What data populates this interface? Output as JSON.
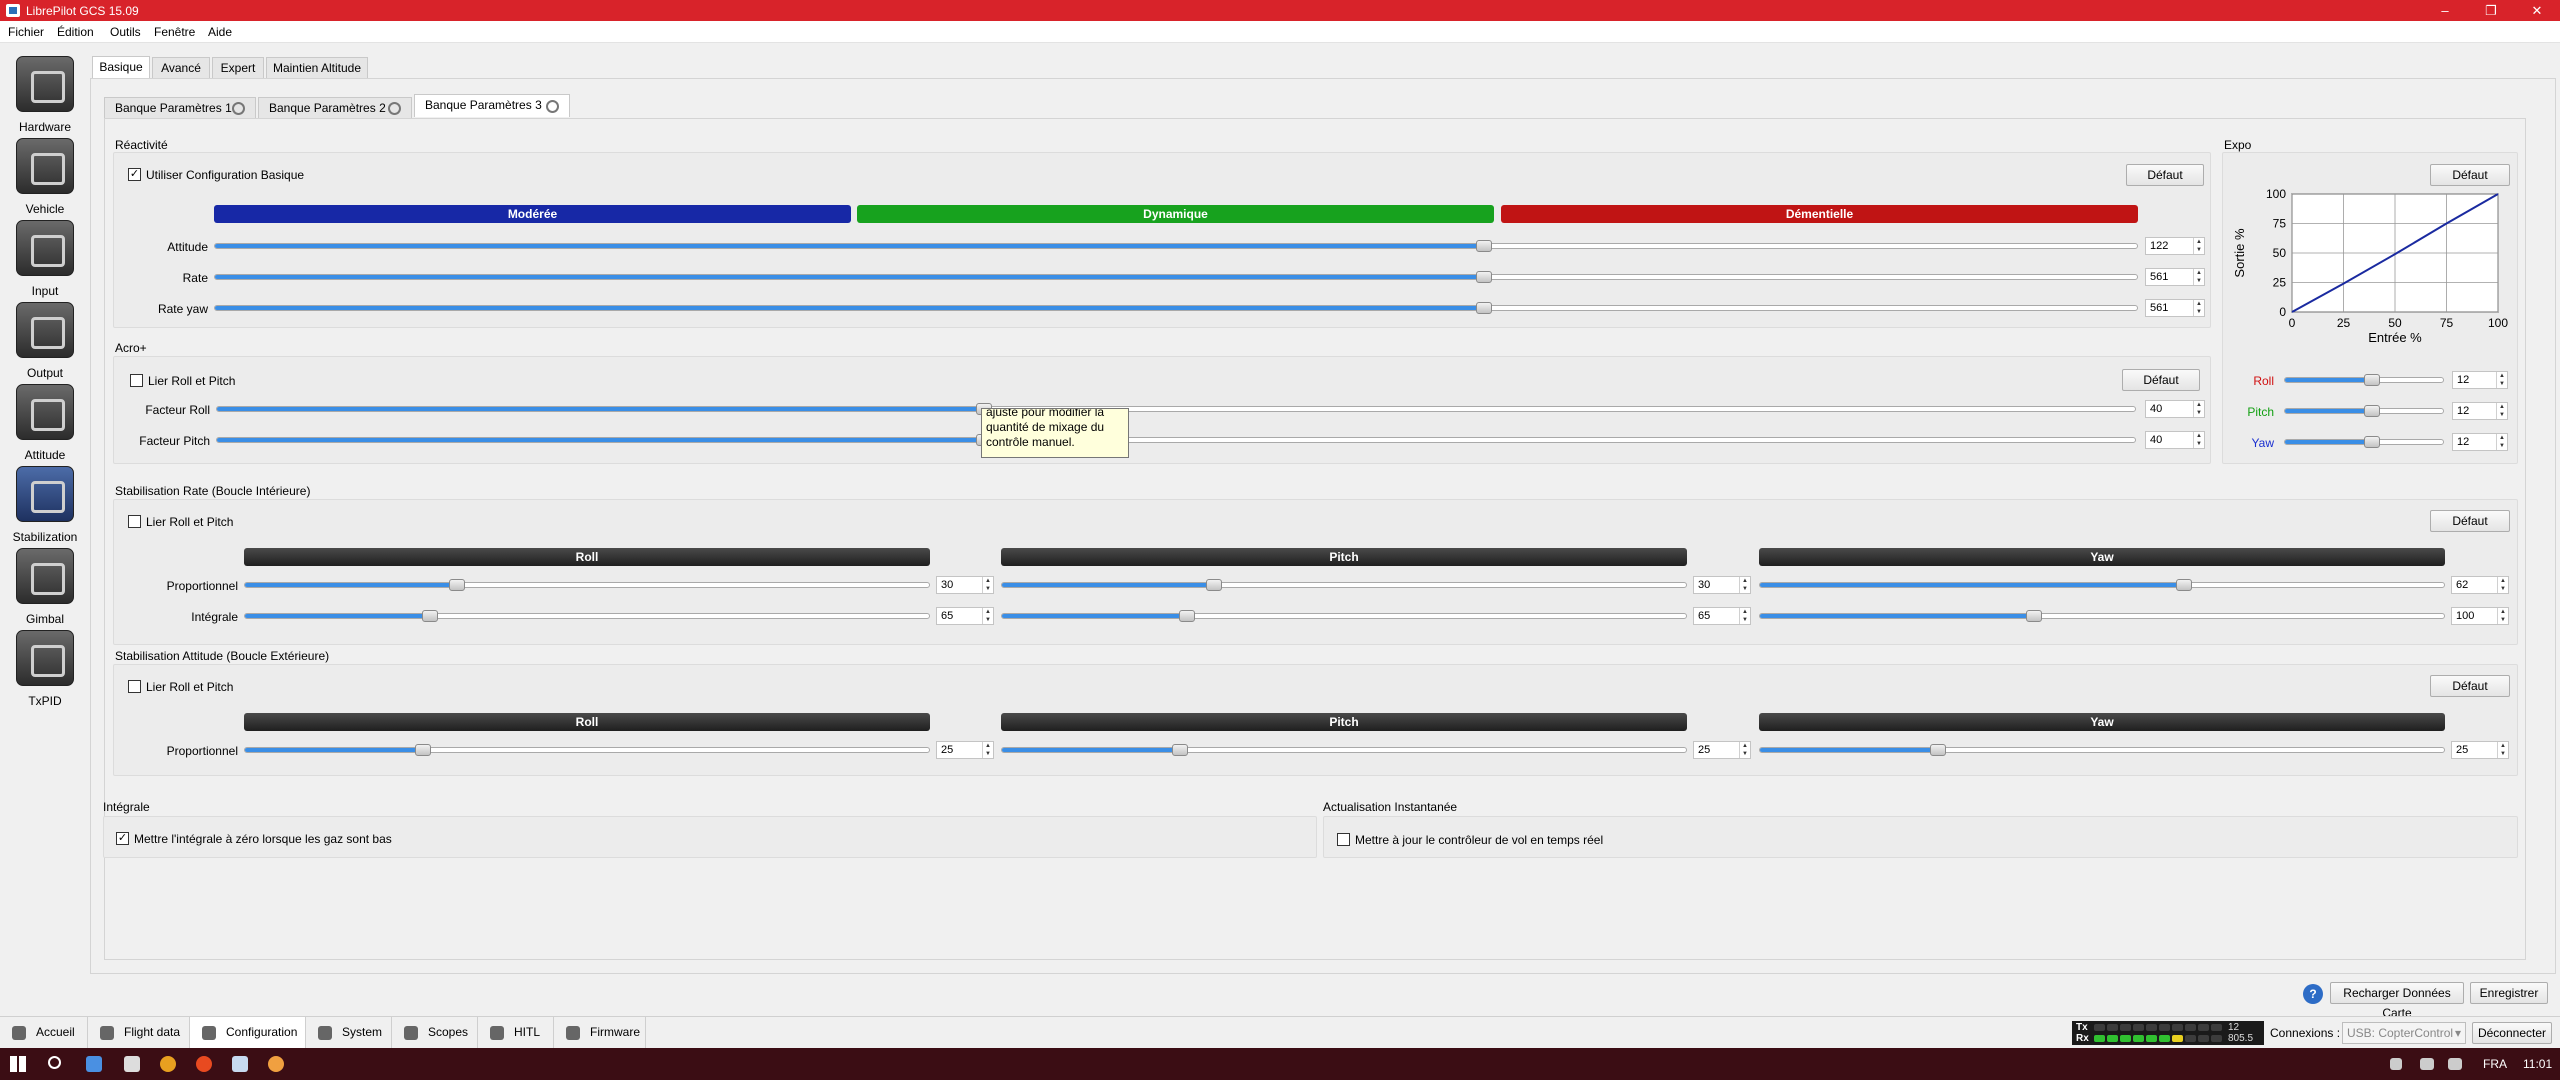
{
  "window": {
    "title": "LibrePilot GCS 15.09",
    "controls": [
      "–",
      "❐",
      "✕"
    ]
  },
  "menu": [
    "Fichier",
    "Édition",
    "Outils",
    "Fenêtre",
    "Aide"
  ],
  "sidebar": [
    "Hardware",
    "Vehicle",
    "Input",
    "Output",
    "Attitude",
    "Stabilization",
    "Gimbal",
    "TxPID"
  ],
  "tabs": [
    "Basique",
    "Avancé",
    "Expert",
    "Maintien Altitude"
  ],
  "banks": [
    "Banque Paramètres 1",
    "Banque Paramètres 2",
    "Banque Paramètres 3"
  ],
  "reactivite": {
    "title": "Réactivité",
    "basic_config": "Utiliser Configuration Basique",
    "default": "Défaut",
    "modes": [
      "Modérée",
      "Dynamique",
      "Démentielle"
    ],
    "mode_colors": [
      "#1728a6",
      "#17a21e",
      "#c01414"
    ],
    "rows": [
      {
        "label": "Attitude",
        "value": "122",
        "level": 0.66
      },
      {
        "label": "Rate",
        "value": "561",
        "level": 0.66
      },
      {
        "label": "Rate yaw",
        "value": "561",
        "level": 0.66
      }
    ]
  },
  "acro": {
    "title": "Acro+",
    "link": "Lier Roll et Pitch",
    "default": "Défaut",
    "rows": [
      {
        "label": "Facteur Roll",
        "value": "40",
        "level": 0.4
      },
      {
        "label": "Facteur Pitch",
        "value": "40",
        "level": 0.4
      }
    ],
    "tooltip": [
      "ajuste pour modifier la",
      "quantité de mixage du",
      "contrôle manuel."
    ]
  },
  "expo": {
    "title": "Expo",
    "default": "Défaut",
    "ylabel": "Sortie %",
    "xlabel": "Entrée %",
    "yticks": [
      "100",
      "75",
      "50",
      "25",
      "0"
    ],
    "xticks": [
      "0",
      "25",
      "50",
      "75",
      "100"
    ],
    "rows": [
      {
        "label": "Roll",
        "value": "12",
        "color": "#d01010",
        "level": 0.55
      },
      {
        "label": "Pitch",
        "value": "12",
        "color": "#12a012",
        "level": 0.55
      },
      {
        "label": "Yaw",
        "value": "12",
        "color": "#1a2fd0",
        "level": 0.55
      }
    ]
  },
  "chart_data": {
    "type": "line",
    "xlabel": "Entrée %",
    "ylabel": "Sortie %",
    "xlim": [
      0,
      100
    ],
    "ylim": [
      0,
      100
    ],
    "x": [
      0,
      25,
      50,
      75,
      100
    ],
    "series": [
      {
        "values": [
          0,
          24,
          49,
          75,
          100
        ]
      }
    ],
    "grid": true
  },
  "rate_stab": {
    "title": "Stabilisation Rate (Boucle Intérieure)",
    "link": "Lier Roll et Pitch",
    "default": "Défaut",
    "headers": [
      "Roll",
      "Pitch",
      "Yaw"
    ],
    "rows": [
      {
        "label": "Proportionnel",
        "values": [
          "30",
          "30",
          "62"
        ],
        "levels": [
          0.31,
          0.31,
          0.62
        ]
      },
      {
        "label": "Intégrale",
        "values": [
          "65",
          "65",
          "100"
        ],
        "levels": [
          0.27,
          0.27,
          0.4
        ]
      }
    ]
  },
  "att_stab": {
    "title": "Stabilisation Attitude (Boucle Extérieure)",
    "link": "Lier Roll et Pitch",
    "default": "Défaut",
    "headers": [
      "Roll",
      "Pitch",
      "Yaw"
    ],
    "rows": [
      {
        "label": "Proportionnel",
        "values": [
          "25",
          "25",
          "25"
        ],
        "levels": [
          0.26,
          0.26,
          0.26
        ]
      }
    ]
  },
  "integrale": {
    "title": "Intégrale",
    "option": "Mettre l'intégrale à zéro lorsque les gaz sont bas"
  },
  "actualisation": {
    "title": "Actualisation Instantanée",
    "option": "Mettre à jour le contrôleur de vol en temps réel"
  },
  "actions": {
    "reload": "Recharger Données Carte",
    "save": "Enregistrer",
    "help": "?"
  },
  "modes_bar": [
    "Accueil",
    "Flight data",
    "Configuration",
    "System",
    "Scopes",
    "HITL",
    "Firmware"
  ],
  "status": {
    "tx": "Tx",
    "rx": "Rx",
    "tx_val": "12",
    "rx_val": "805.5",
    "connections_label": "Connexions :",
    "connection": "USB: CopterControl",
    "disconnect": "Déconnecter"
  },
  "taskbar": {
    "lang": "FRA",
    "time": "11:01"
  }
}
